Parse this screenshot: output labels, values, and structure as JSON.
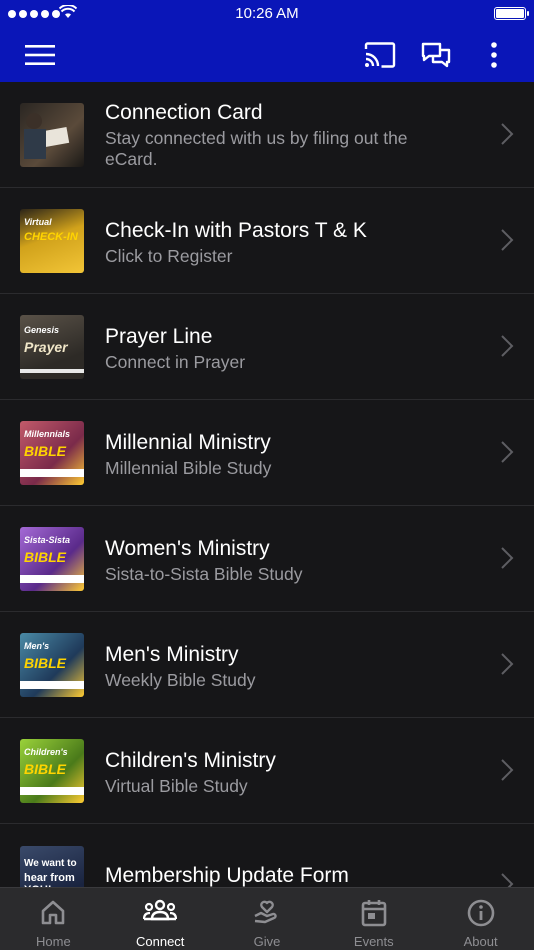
{
  "status": {
    "time": "10:26 AM"
  },
  "colors": {
    "accent": "#0a16b8",
    "background": "#161618",
    "tab_inactive": "#8e8e92",
    "tab_active": "#ffffff"
  },
  "navbar": {
    "icons": [
      "menu-icon",
      "cast-icon",
      "chat-icon",
      "more-vertical-icon"
    ]
  },
  "items": [
    {
      "title": "Connection Card",
      "subtitle": "Stay connected with us by filing out the eCard.",
      "thumb_line1": "",
      "thumb_line2": "",
      "thumb_color": "#2a2622"
    },
    {
      "title": "Check-In with Pastors T & K",
      "subtitle": "Click to Register",
      "thumb_line1": "Virtual",
      "thumb_line2": "CHECK-IN",
      "thumb_color": "#d1a21b"
    },
    {
      "title": "Prayer Line",
      "subtitle": "Connect in Prayer",
      "thumb_line1": "Genesis",
      "thumb_line2": "Prayer",
      "thumb_color": "#3d3a35"
    },
    {
      "title": "Millennial Ministry",
      "subtitle": "Millennial Bible Study",
      "thumb_line1": "Millennials",
      "thumb_line2": "BIBLE",
      "thumb_color": "#9b3a5a"
    },
    {
      "title": "Women's Ministry",
      "subtitle": "Sista-to-Sista Bible Study",
      "thumb_line1": "Sista-Sista",
      "thumb_line2": "BIBLE",
      "thumb_color": "#6a3a9a"
    },
    {
      "title": "Men's Ministry",
      "subtitle": "Weekly Bible Study",
      "thumb_line1": "Men's",
      "thumb_line2": "BIBLE",
      "thumb_color": "#2f5a7a"
    },
    {
      "title": "Children's Ministry",
      "subtitle": "Virtual Bible Study",
      "thumb_line1": "Children's",
      "thumb_line2": "BIBLE",
      "thumb_color": "#6d9a2a"
    },
    {
      "title": "Membership Update Form",
      "subtitle": "",
      "thumb_line1": "We want to",
      "thumb_line2": "hear from YOU!",
      "thumb_color": "#2d3e62"
    }
  ],
  "tabs": [
    {
      "label": "Home",
      "icon": "home-icon",
      "active": false
    },
    {
      "label": "Connect",
      "icon": "people-icon",
      "active": true
    },
    {
      "label": "Give",
      "icon": "give-heart-hand-icon",
      "active": false
    },
    {
      "label": "Events",
      "icon": "calendar-icon",
      "active": false
    },
    {
      "label": "About",
      "icon": "info-icon",
      "active": false
    }
  ]
}
